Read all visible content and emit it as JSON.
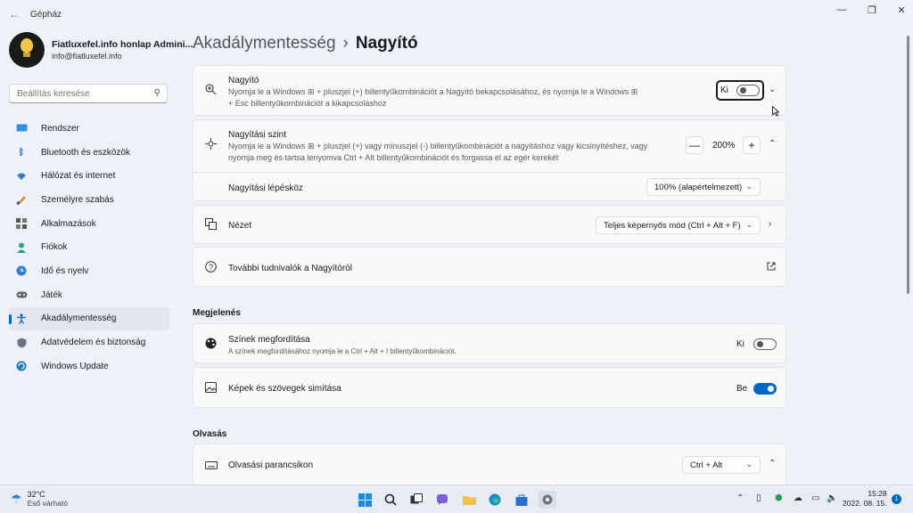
{
  "window": {
    "title": "Gépház",
    "back": "←",
    "minimize": "—",
    "maximize": "❐",
    "close": "✕"
  },
  "profile": {
    "name": "Fiatluxefel.info honlap Admini...",
    "email": "info@fiatluxefel.info"
  },
  "search": {
    "placeholder": "Beállítás keresése",
    "icon": "search-icon"
  },
  "nav": [
    {
      "label": "Rendszer",
      "icon": "monitor-icon"
    },
    {
      "label": "Bluetooth és eszközök",
      "icon": "bluetooth-icon"
    },
    {
      "label": "Hálózat és internet",
      "icon": "wifi-icon"
    },
    {
      "label": "Személyre szabás",
      "icon": "brush-icon"
    },
    {
      "label": "Alkalmazások",
      "icon": "apps-icon"
    },
    {
      "label": "Fiókok",
      "icon": "person-icon"
    },
    {
      "label": "Idő és nyelv",
      "icon": "globe-clock-icon"
    },
    {
      "label": "Játék",
      "icon": "gamepad-icon"
    },
    {
      "label": "Akadálymentesség",
      "icon": "accessibility-icon",
      "active": true
    },
    {
      "label": "Adatvédelem és biztonság",
      "icon": "shield-icon"
    },
    {
      "label": "Windows Update",
      "icon": "update-icon"
    }
  ],
  "breadcrumb": {
    "parent": "Akadálymentesség",
    "separator": "›",
    "current": "Nagyító"
  },
  "magnifier": {
    "title": "Nagyító",
    "desc1": "Nyomja le a Windows ⊞ + pluszjel (+) billentyűkombinációt a Nagyító bekapcsolásához, és nyomja le a Windows ⊞",
    "desc2": "+ Esc billentyűkombinációt a kikapcsoláshoz",
    "state_label": "Ki",
    "on": false
  },
  "zoom": {
    "title": "Nagyítási szint",
    "desc1": "Nyomja le a Windows ⊞ + pluszjel (+) vagy mínuszjel (-) billentyűkombinációt a nagyításhoz vagy kicsinyítéshez, vagy",
    "desc2": "nyomja meg és tartsa lenyomva Ctrl + Alt billentyűkombinációt és forgassa el az egér kerekét",
    "value": "200%",
    "minus": "—",
    "plus": "+"
  },
  "increment": {
    "label": "Nagyítási lépésköz",
    "value": "100% (alapértelmezett)"
  },
  "view": {
    "label": "Nézet",
    "value": "Teljes képernyős mód (Ctrl + Alt + F)"
  },
  "more": {
    "label": "További tudnivalók a Nagyítóról"
  },
  "sections": {
    "appearance": "Megjelenés",
    "reading": "Olvasás"
  },
  "invert": {
    "title": "Színek megfordítása",
    "desc": "A színek megfordításához nyomja le a Ctrl + Alt + I billentyűkombinációt.",
    "state_label": "Ki",
    "on": false
  },
  "smoothing": {
    "title": "Képek és szövegek simítása",
    "state_label": "Be",
    "on": true
  },
  "reading": {
    "title": "Olvasási parancsikon",
    "value": "Ctrl + Alt"
  },
  "taskbar": {
    "temp": "32°C",
    "weather": "Eső várható",
    "time": "15:28",
    "date": "2022. 08. 15.",
    "notification_count": "1"
  },
  "colors": {
    "accent": "#0067c0"
  }
}
